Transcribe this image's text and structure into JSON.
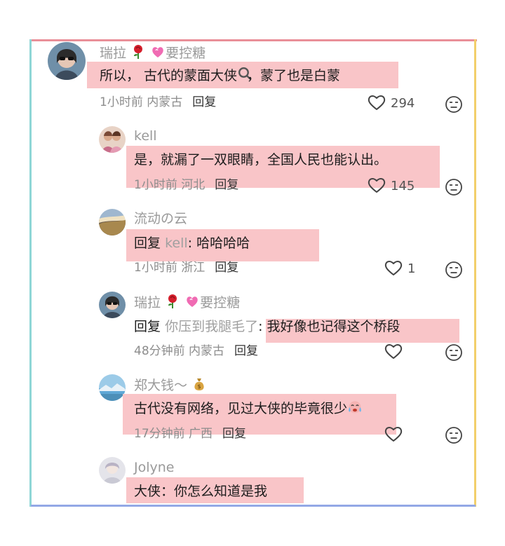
{
  "comments": [
    {
      "username": "瑞拉",
      "username_suffix": "要控糖",
      "text_before": "所以， 古代的蒙面大侠",
      "text_after": "，蒙了也是白蒙",
      "time": "1小时前",
      "location": "内蒙古",
      "reply_label": "回复",
      "likes": "294"
    },
    {
      "username": "kell",
      "text": "是，就漏了一双眼睛，全国人民也能认出。",
      "time": "1小时前",
      "location": "河北",
      "reply_label": "回复",
      "likes": "145"
    },
    {
      "username": "流动の云",
      "reply_prefix": "回复",
      "reply_to": "kell",
      "text": ": 哈哈哈哈",
      "time": "1小时前",
      "location": "浙江",
      "reply_label": "回复",
      "likes": "1"
    },
    {
      "username": "瑞拉",
      "username_suffix": "要控糖",
      "reply_prefix": "回复",
      "reply_to": "你压到我腿毛了",
      "text": ": 我好像也记得这个桥段",
      "time": "48分钟前",
      "location": "内蒙古",
      "reply_label": "回复",
      "likes": ""
    },
    {
      "username": "郑大钱～",
      "text": "古代没有网络，见过大侠的毕竟很少",
      "time": "17分钟前",
      "location": "广西",
      "reply_label": "回复",
      "likes": ""
    },
    {
      "username": "Jolyne",
      "text": "大侠：你怎么知道是我"
    }
  ],
  "icons": {
    "like": "heart-outline-icon",
    "dislike": "unamused-face-icon",
    "rose": "rose-emoji",
    "heart": "sparkling-heart-emoji",
    "money": "money-bag-emoji",
    "search": "magnifier-icon",
    "crying": "crying-face-emoji"
  },
  "colors": {
    "highlight": "#f9c5c8",
    "frame_top": "#e98f98",
    "frame_left": "#8fd6d6",
    "frame_right": "#f2cf6a",
    "frame_bottom": "#93a8e6"
  }
}
